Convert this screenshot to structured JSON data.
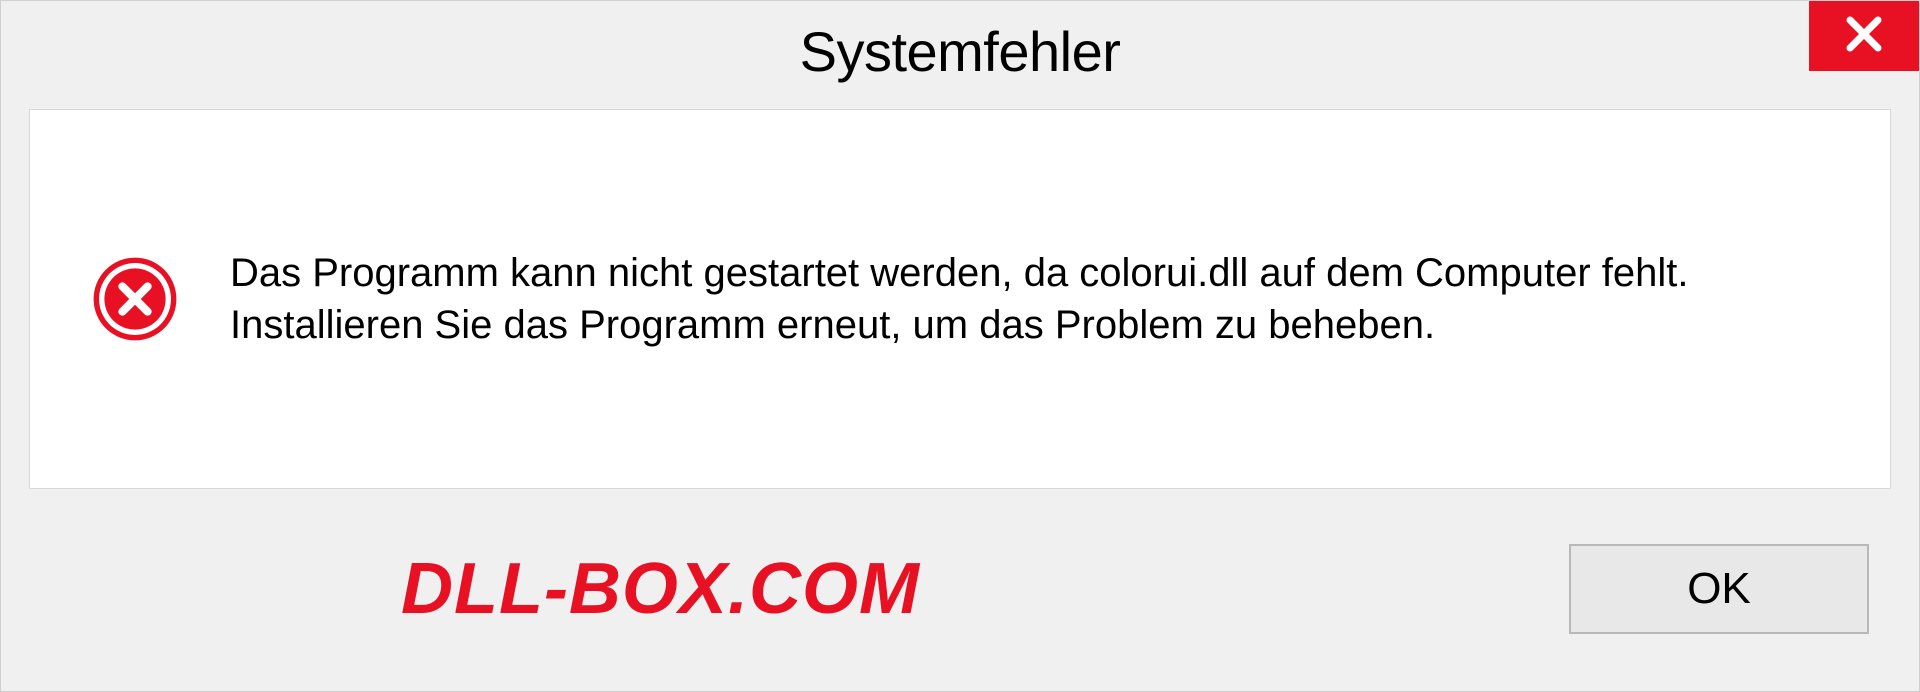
{
  "dialog": {
    "title": "Systemfehler",
    "message": "Das Programm kann nicht gestartet werden, da colorui.dll auf dem Computer fehlt. Installieren Sie das Programm erneut, um das Problem zu beheben.",
    "ok_label": "OK"
  },
  "watermark": "DLL-BOX.COM"
}
